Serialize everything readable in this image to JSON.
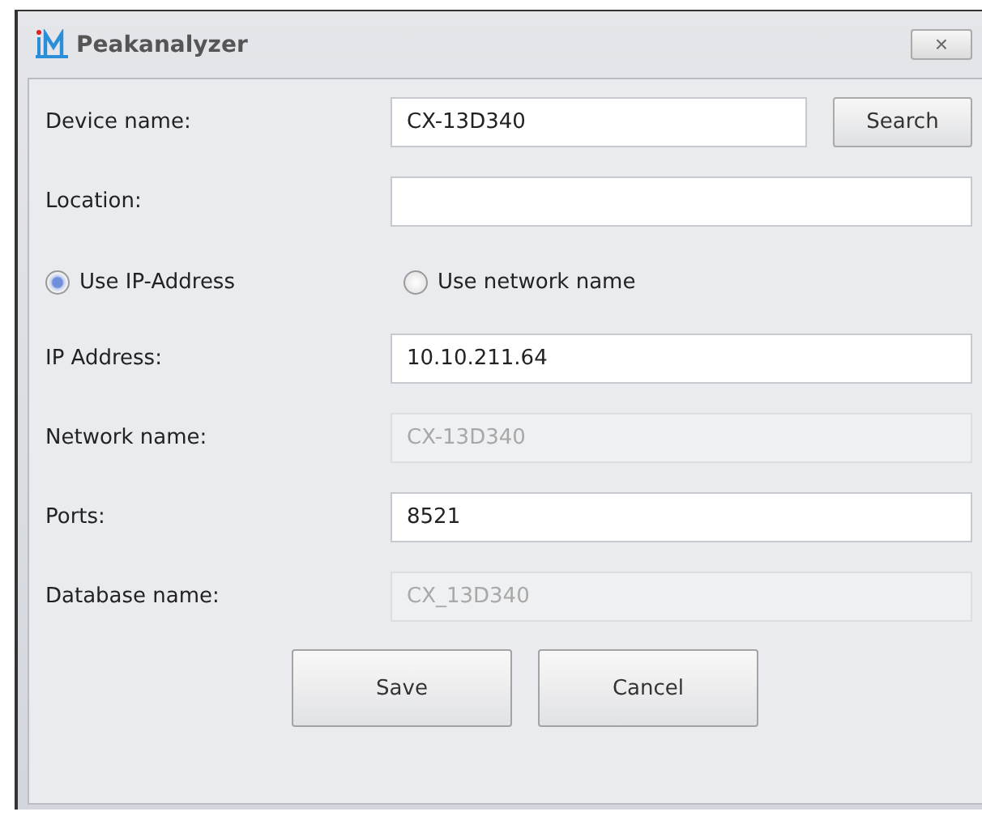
{
  "window": {
    "title": "Peakanalyzer",
    "close": "×"
  },
  "fields_top": [
    {
      "label": "Device name:",
      "value": "CX-13D340",
      "disabled": false,
      "button": "Search"
    },
    {
      "label": "Location:",
      "disabled": false
    }
  ],
  "radios": [
    {
      "label": "Use IP-Address",
      "selected": true
    },
    {
      "label": "Use network name",
      "selected": false
    }
  ],
  "fields": [
    {
      "label": "IP Address:",
      "value": "10.10.211.64",
      "disabled": false
    },
    {
      "label": "Network name:",
      "value": "CX-13D340",
      "disabled": true
    },
    {
      "label": "Ports:",
      "value": "8521",
      "disabled": false
    },
    {
      "label": "Database name:",
      "value": "CX_13D340",
      "disabled": true
    }
  ],
  "buttons": [
    "Save",
    "Cancel"
  ]
}
